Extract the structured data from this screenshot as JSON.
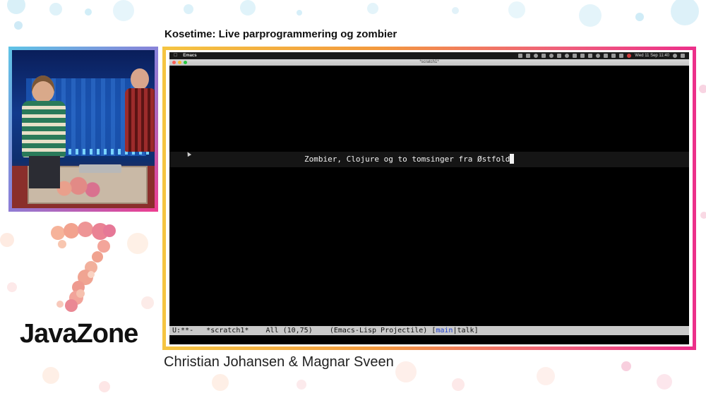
{
  "talk": {
    "title": "Kosetime: Live parprogrammering og zombier",
    "speakers": "Christian Johansen & Magnar Sveen"
  },
  "brand": {
    "name": "JavaZone",
    "accent_colors": [
      "#5ec4e6",
      "#ee3d8f",
      "#f5c542",
      "#e9a08c"
    ]
  },
  "menubar": {
    "apple_icon": "",
    "app_name": "Emacs",
    "clock": "Wed 11 Sep  11:40"
  },
  "window": {
    "title": "*scratch1*"
  },
  "buffer": {
    "text": "Zombier, Clojure og to tomsinger fra Østfold"
  },
  "mode_line": {
    "status": "U:**-",
    "buffer_name": "*scratch1*",
    "position": "All (10,75)",
    "modes": "(Emacs-Lisp Projectile)",
    "branch": "main",
    "branch_separator": "|",
    "extra": "talk",
    "bracket_open": "[",
    "bracket_close": "]"
  }
}
